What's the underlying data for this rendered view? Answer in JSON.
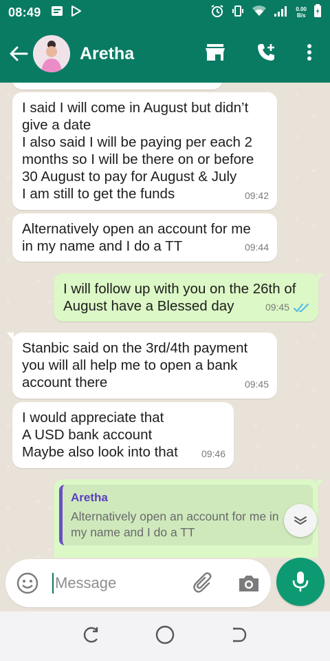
{
  "status_bar": {
    "time": "08:49",
    "speed_value": "0.00",
    "speed_unit": "B/s"
  },
  "header": {
    "contact_name": "Aretha"
  },
  "messages": [
    {
      "direction": "incoming",
      "text": "I said I will come in August but didn’t\ngive a date\nI also said I will be paying per each 2\nmonths so I will be there on or before\n30 August to pay for August & July\nI am still to get the funds",
      "time": "09:42"
    },
    {
      "direction": "incoming",
      "text": "Alternatively open an account for me\nin my name and I do a TT",
      "time": "09:44"
    },
    {
      "direction": "outgoing",
      "text": "I will follow up with you on the 26th of\nAugust have a Blessed day",
      "time": "09:45",
      "status": "read"
    },
    {
      "direction": "incoming",
      "text": "Stanbic said on the 3rd/4th payment\nyou will all help me to open a bank\naccount there",
      "time": "09:45"
    },
    {
      "direction": "incoming",
      "text": "I would appreciate that\nA USD bank account\nMaybe also look into that",
      "time": "09:46"
    }
  ],
  "reply_preview": {
    "quoted_name": "Aretha",
    "quoted_text": "Alternatively open an account for me in\nmy name and I do a TT"
  },
  "composer": {
    "placeholder": "Message"
  },
  "colors": {
    "header": "#0a7b63",
    "outgoing_bubble": "#dcf8c6",
    "incoming_bubble": "#ffffff",
    "read_ticks": "#4fb6ec",
    "mic_button": "#0d9a72"
  }
}
